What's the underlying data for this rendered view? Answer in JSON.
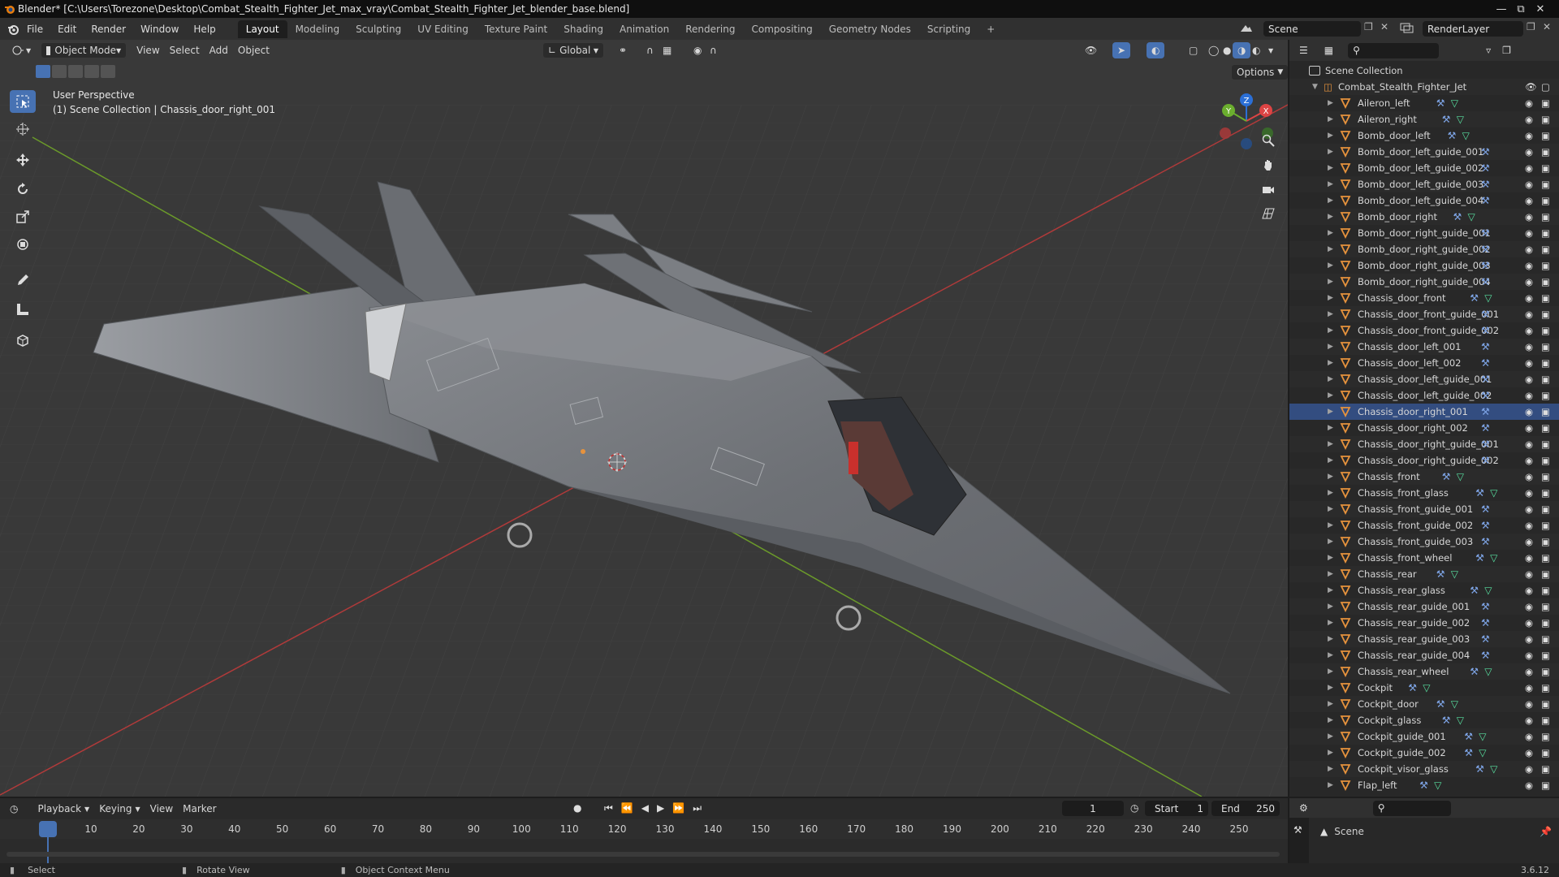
{
  "window": {
    "title": "Blender* [C:\\Users\\Torezone\\Desktop\\Combat_Stealth_Fighter_Jet_max_vray\\Combat_Stealth_Fighter_Jet_blender_base.blend]"
  },
  "menu": {
    "items": [
      "File",
      "Edit",
      "Render",
      "Window",
      "Help"
    ]
  },
  "workspaces": {
    "tabs": [
      "Layout",
      "Modeling",
      "Sculpting",
      "UV Editing",
      "Texture Paint",
      "Shading",
      "Animation",
      "Rendering",
      "Compositing",
      "Geometry Nodes",
      "Scripting"
    ],
    "active": "Layout",
    "add": "+"
  },
  "scene": {
    "name": "Scene",
    "view_layer": "RenderLayer"
  },
  "viewport": {
    "mode": "Object Mode",
    "menus": [
      "View",
      "Select",
      "Add",
      "Object"
    ],
    "transform_orientation": "Global",
    "options_label": "Options",
    "perspective_label": "User Perspective",
    "active_info": "(1) Scene Collection | Chassis_door_right_001",
    "gizmo": {
      "x": "X",
      "y": "Y",
      "z": "Z"
    }
  },
  "outliner": {
    "root": "Scene Collection",
    "collection": "Combat_Stealth_Fighter_Jet",
    "active_item": "Chassis_door_right_001",
    "items": [
      "Aileron_left",
      "Aileron_right",
      "Bomb_door_left",
      "Bomb_door_left_guide_001",
      "Bomb_door_left_guide_002",
      "Bomb_door_left_guide_003",
      "Bomb_door_left_guide_004",
      "Bomb_door_right",
      "Bomb_door_right_guide_001",
      "Bomb_door_right_guide_002",
      "Bomb_door_right_guide_003",
      "Bomb_door_right_guide_004",
      "Chassis_door_front",
      "Chassis_door_front_guide_001",
      "Chassis_door_front_guide_002",
      "Chassis_door_left_001",
      "Chassis_door_left_002",
      "Chassis_door_left_guide_001",
      "Chassis_door_left_guide_002",
      "Chassis_door_right_001",
      "Chassis_door_right_002",
      "Chassis_door_right_guide_001",
      "Chassis_door_right_guide_002",
      "Chassis_front",
      "Chassis_front_glass",
      "Chassis_front_guide_001",
      "Chassis_front_guide_002",
      "Chassis_front_guide_003",
      "Chassis_front_wheel",
      "Chassis_rear",
      "Chassis_rear_glass",
      "Chassis_rear_guide_001",
      "Chassis_rear_guide_002",
      "Chassis_rear_guide_003",
      "Chassis_rear_guide_004",
      "Chassis_rear_wheel",
      "Cockpit",
      "Cockpit_door",
      "Cockpit_glass",
      "Cockpit_guide_001",
      "Cockpit_guide_002",
      "Cockpit_visor_glass",
      "Flap_left"
    ]
  },
  "properties": {
    "context": "Scene"
  },
  "timeline": {
    "menus": [
      "Playback",
      "Keying",
      "View",
      "Marker"
    ],
    "current_frame": "1",
    "start_label": "Start",
    "start": "1",
    "end_label": "End",
    "end": "250",
    "ticks": [
      "1",
      "10",
      "20",
      "30",
      "40",
      "50",
      "60",
      "70",
      "80",
      "90",
      "100",
      "110",
      "120",
      "130",
      "140",
      "150",
      "160",
      "170",
      "180",
      "190",
      "200",
      "210",
      "220",
      "230",
      "240",
      "250"
    ]
  },
  "statusbar": {
    "select": "Select",
    "rotate": "Rotate View",
    "context_menu": "Object Context Menu",
    "version": "3.6.12"
  },
  "colors": {
    "accent": "#4772b3",
    "x_axis": "#b03a3a",
    "y_axis": "#6b9a2a",
    "object_icon": "#e7933d",
    "modifier_icon": "#7fa6e8",
    "mesh_icon": "#58e0a0"
  }
}
